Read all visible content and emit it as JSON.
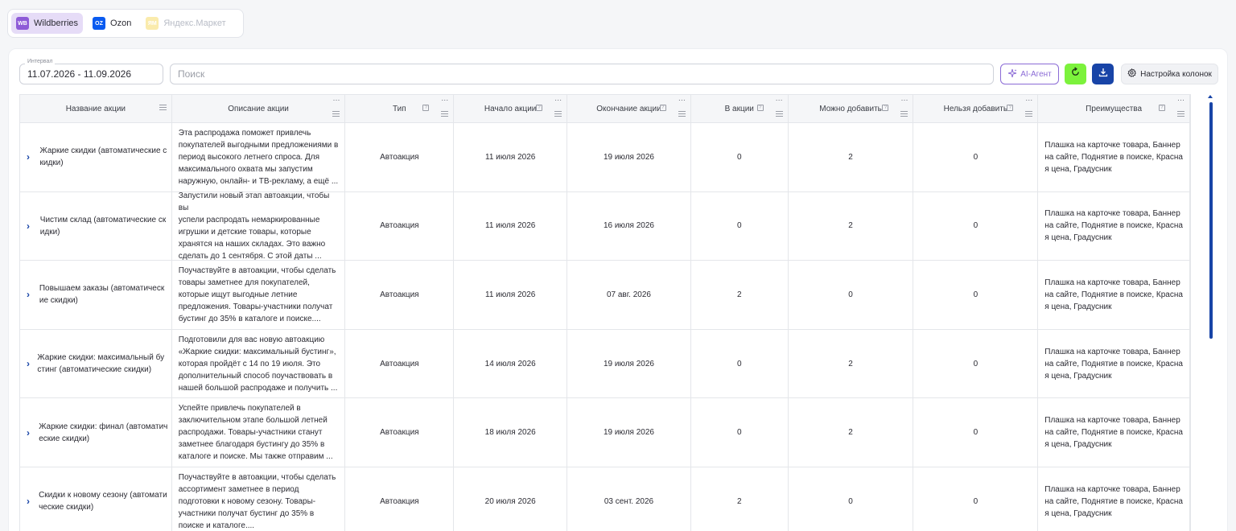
{
  "marketplaces": [
    {
      "id": "wb",
      "logo": "WB",
      "label": "Wildberries",
      "color": "#8e5bd7",
      "active": true,
      "disabled": false
    },
    {
      "id": "oz",
      "logo": "OZ",
      "label": "Ozon",
      "color": "#0a5bf0",
      "active": false,
      "disabled": false
    },
    {
      "id": "ym",
      "logo": "ЯМ",
      "label": "Яндекс.Маркет",
      "color": "#f5d34a",
      "active": false,
      "disabled": true
    }
  ],
  "toolbar": {
    "interval_label": "Интервал",
    "interval_value": "11.07.2026 - 11.09.2026",
    "search_placeholder": "Поиск",
    "ai_label": "AI-Агент",
    "columns_label": "Настройка колонок"
  },
  "colors": {
    "accent": "#1844a7",
    "refresh": "#7cf23c",
    "ai": "#8b6bd6"
  },
  "table": {
    "columns": [
      {
        "key": "name",
        "label": "Название акции",
        "width": 189,
        "sort": false
      },
      {
        "key": "desc",
        "label": "Описание акции",
        "width": 216,
        "sort": false
      },
      {
        "key": "type",
        "label": "Тип",
        "width": 135,
        "sort": true
      },
      {
        "key": "start",
        "label": "Начало акции",
        "width": 141,
        "sort": true
      },
      {
        "key": "end",
        "label": "Окончание акции",
        "width": 154,
        "sort": true
      },
      {
        "key": "in",
        "label": "В акции",
        "width": 121,
        "sort": true
      },
      {
        "key": "can",
        "label": "Можно добавить",
        "width": 156,
        "sort": true
      },
      {
        "key": "cannot",
        "label": "Нельзя добавить",
        "width": 155,
        "sort": true
      },
      {
        "key": "adv",
        "label": "Преимущества",
        "width": 189,
        "sort": true
      }
    ],
    "rows": [
      {
        "name": "Жаркие скидки (автоматические скидки)",
        "desc": [
          "Эта распродажа поможет привлечь",
          "покупателей выгодными предложениями в",
          "период высокого летнего спроса. Для",
          "максимального охвата мы запустим",
          "наружную, онлайн- и ТВ-рекламу, а ещё ..."
        ],
        "type": "Автоакция",
        "start": "11 июля 2026",
        "end": "19 июля 2026",
        "in": "0",
        "can": "2",
        "cannot": "0",
        "adv": "Плашка на карточке товара, Баннер на сайте, Поднятие в поиске, Красная цена, Градусник"
      },
      {
        "name": "Чистим склад (автоматические скидки)",
        "desc": [
          "Запустили новый этап автоакции, чтобы вы",
          "успели распродать немаркированные",
          "игрушки и детские товары, которые",
          "хранятся на наших складах. Это важно",
          "сделать до 1 сентября. С этой даты ..."
        ],
        "type": "Автоакция",
        "start": "11 июля 2026",
        "end": "16 июля 2026",
        "in": "0",
        "can": "2",
        "cannot": "0",
        "adv": "Плашка на карточке товара, Баннер на сайте, Поднятие в поиске, Красная цена, Градусник"
      },
      {
        "name": "Повышаем заказы (автоматические скидки)",
        "desc": [
          "Поучаствуйте в автоакции, чтобы сделать",
          "товары заметнее для покупателей,",
          "которые ищут выгодные летние",
          "предложения. Товары-участники получат",
          "бустинг до 35% в каталоге и поиске...."
        ],
        "type": "Автоакция",
        "start": "11 июля 2026",
        "end": "07 авг. 2026",
        "in": "2",
        "can": "0",
        "cannot": "0",
        "adv": "Плашка на карточке товара, Баннер на сайте, Поднятие в поиске, Красная цена, Градусник"
      },
      {
        "name": "Жаркие скидки: максимальный бустинг (автоматические скидки)",
        "desc": [
          "Подготовили для вас новую автоакцию",
          "«Жаркие скидки: максимальный бустинг»,",
          "которая пройдёт с 14 по 19 июля. Это",
          "дополнительный способ поучаствовать в",
          "нашей большой распродаже и получить ..."
        ],
        "type": "Автоакция",
        "start": "14 июля 2026",
        "end": "19 июля 2026",
        "in": "0",
        "can": "2",
        "cannot": "0",
        "adv": "Плашка на карточке товара, Баннер на сайте, Поднятие в поиске, Красная цена, Градусник"
      },
      {
        "name": "Жаркие скидки: финал (автоматические скидки)",
        "desc": [
          "Успейте привлечь покупателей в",
          "заключительном этапе большой летней",
          "распродажи. Товары-участники станут",
          "заметнее благодаря бустингу до 35% в",
          "каталоге и поиске. Мы также отправим ..."
        ],
        "type": "Автоакция",
        "start": "18 июля 2026",
        "end": "19 июля 2026",
        "in": "0",
        "can": "2",
        "cannot": "0",
        "adv": "Плашка на карточке товара, Баннер на сайте, Поднятие в поиске, Красная цена, Градусник"
      },
      {
        "name": "Скидки к новому сезону (автоматические скидки)",
        "desc": [
          "Поучаствуйте в автоакции, чтобы сделать",
          "ассортимент заметнее в период",
          "подготовки к новому сезону. Товары-",
          "участники получат бустинг до 35% в",
          "поиске и каталоге...."
        ],
        "type": "Автоакция",
        "start": "20 июля 2026",
        "end": "03 сент. 2026",
        "in": "2",
        "can": "0",
        "cannot": "0",
        "adv": "Плашка на карточке товара, Баннер на сайте, Поднятие в поиске, Красная цена, Градусник"
      }
    ]
  }
}
